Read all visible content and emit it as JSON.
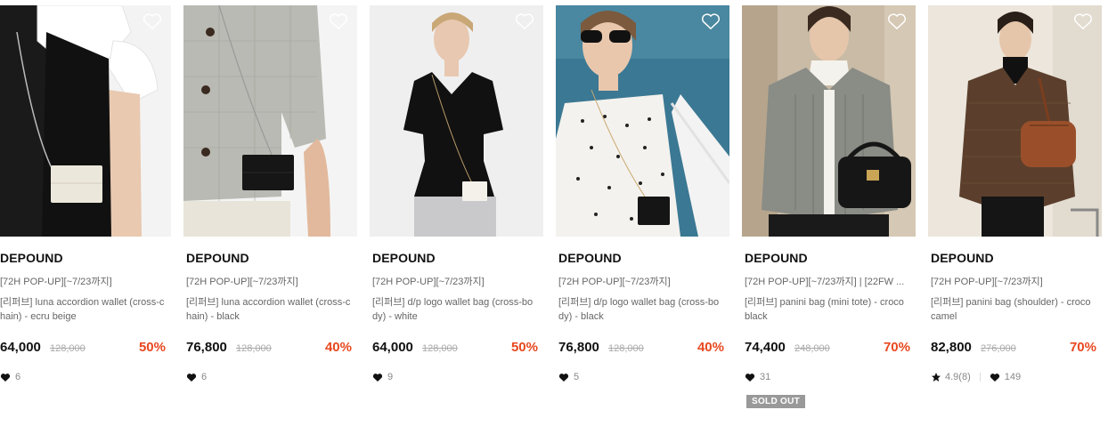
{
  "colors": {
    "discount": "#e8481f",
    "text": "#111111",
    "muted": "#666666",
    "soldout_bg": "#999999"
  },
  "products": [
    {
      "brand": "DEPOUND",
      "promo": "[72H POP-UP][~7/23까지]",
      "name": "[리퍼브] luna accordion wallet (cross-chain) - ecru beige",
      "price": "64,000",
      "original": "128,000",
      "discount": "50%",
      "likes": "6",
      "rating": "",
      "rating_count": "",
      "soldout": ""
    },
    {
      "brand": "DEPOUND",
      "promo": "[72H POP-UP][~7/23까지]",
      "name": "[리퍼브] luna accordion wallet (cross-chain) - black",
      "price": "76,800",
      "original": "128,000",
      "discount": "40%",
      "likes": "6",
      "rating": "",
      "rating_count": "",
      "soldout": ""
    },
    {
      "brand": "DEPOUND",
      "promo": "[72H POP-UP][~7/23까지]",
      "name": "[리퍼브] d/p logo wallet bag (cross-body) - white",
      "price": "64,000",
      "original": "128,000",
      "discount": "50%",
      "likes": "9",
      "rating": "",
      "rating_count": "",
      "soldout": ""
    },
    {
      "brand": "DEPOUND",
      "promo": "[72H POP-UP][~7/23까지]",
      "name": "[리퍼브] d/p logo wallet bag (cross-body) - black",
      "price": "76,800",
      "original": "128,000",
      "discount": "40%",
      "likes": "5",
      "rating": "",
      "rating_count": "",
      "soldout": ""
    },
    {
      "brand": "DEPOUND",
      "promo": "[72H POP-UP][~7/23까지] | [22FW ...",
      "name": "[리퍼브] panini bag (mini tote) - croco black",
      "price": "74,400",
      "original": "248,000",
      "discount": "70%",
      "likes": "31",
      "rating": "",
      "rating_count": "",
      "soldout": "SOLD OUT"
    },
    {
      "brand": "DEPOUND",
      "promo": "[72H POP-UP][~7/23까지]",
      "name": "[리퍼브] panini bag (shoulder) - croco camel",
      "price": "82,800",
      "original": "276,000",
      "discount": "70%",
      "likes": "149",
      "rating": "4.9",
      "rating_count": "(8)",
      "soldout": ""
    }
  ]
}
